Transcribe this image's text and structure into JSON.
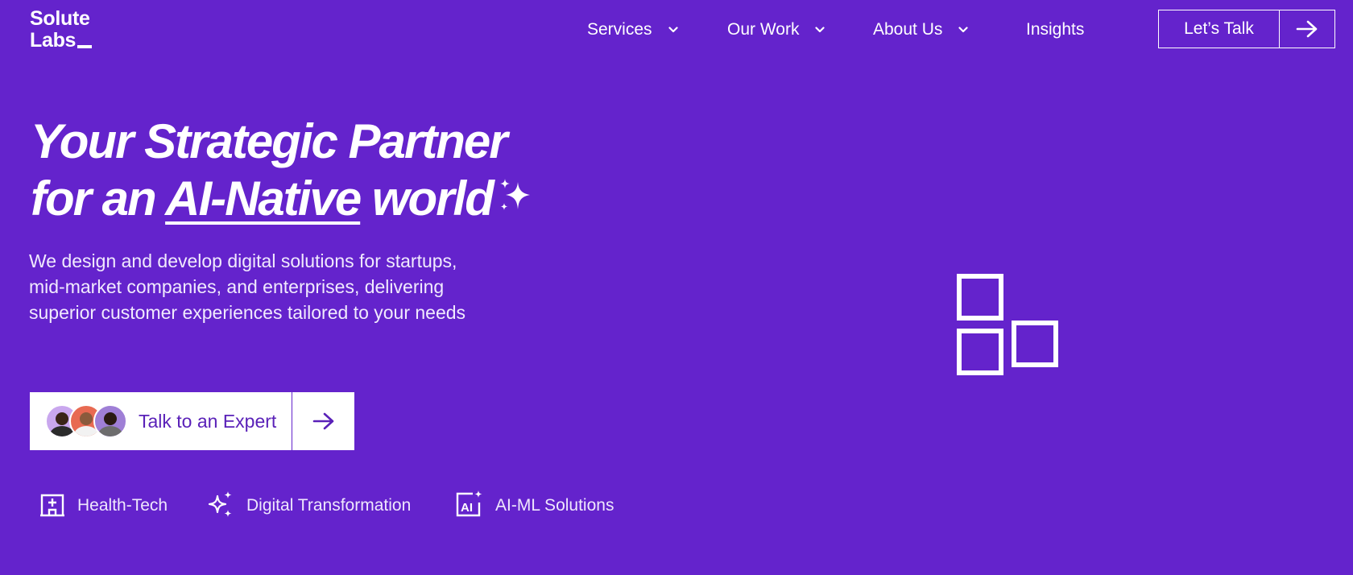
{
  "brand": {
    "logo_line1": "Solute",
    "logo_line2": "Labs"
  },
  "nav": {
    "items": [
      {
        "label": "Services",
        "icon": "chevron-down-icon"
      },
      {
        "label": "Our Work",
        "icon": "chevron-down-icon"
      },
      {
        "label": "About Us",
        "icon": "chevron-down-icon"
      },
      {
        "label": "Insights"
      }
    ],
    "cta_label": "Let’s Talk"
  },
  "hero": {
    "headline_line1": "Your Strategic Partner",
    "headline_line2_pre": "for an ",
    "headline_line2_highlight": "AI-Native",
    "headline_line2_post": " world",
    "subtext": "We design and develop digital solutions for startups, mid-market companies, and enterprises, delivering superior customer experiences tailored to your needs",
    "cta_label": "Talk to an Expert"
  },
  "tags": [
    {
      "label": "Health-Tech",
      "icon": "hospital-icon"
    },
    {
      "label": "Digital Transformation",
      "icon": "sparkles-icon"
    },
    {
      "label": "AI-ML Solutions",
      "icon": "ai-chip-icon"
    }
  ],
  "colors": {
    "background": "#6423cc",
    "accent_text": "#5a21b8",
    "foreground": "#ffffff"
  }
}
